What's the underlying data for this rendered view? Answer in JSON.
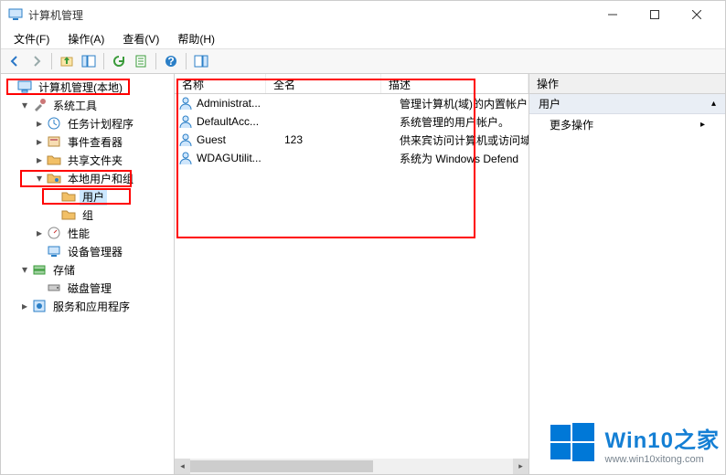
{
  "window": {
    "title": "计算机管理"
  },
  "menu": {
    "file": "文件(F)",
    "action": "操作(A)",
    "view": "查看(V)",
    "help": "帮助(H)"
  },
  "tree": {
    "root": "计算机管理(本地)",
    "system_tools": "系统工具",
    "task_scheduler": "任务计划程序",
    "event_viewer": "事件查看器",
    "shared_folders": "共享文件夹",
    "local_users_groups": "本地用户和组",
    "users": "用户",
    "groups": "组",
    "performance": "性能",
    "device_manager": "设备管理器",
    "storage": "存储",
    "disk_management": "磁盘管理",
    "services_apps": "服务和应用程序"
  },
  "list": {
    "columns": {
      "name": "名称",
      "fullname": "全名",
      "description": "描述"
    },
    "rows": [
      {
        "name": "Administrat...",
        "fullname": "",
        "description": "管理计算机(域)的内置帐户"
      },
      {
        "name": "DefaultAcc...",
        "fullname": "",
        "description": "系统管理的用户帐户。"
      },
      {
        "name": "Guest",
        "fullname": "123",
        "description": "供来宾访问计算机或访问域"
      },
      {
        "name": "WDAGUtilit...",
        "fullname": "",
        "description": "系统为 Windows Defend"
      }
    ]
  },
  "actions_pane": {
    "header": "操作",
    "group": "用户",
    "more": "更多操作"
  },
  "watermark": {
    "brand": "Win10之家",
    "url": "www.win10xitong.com"
  }
}
